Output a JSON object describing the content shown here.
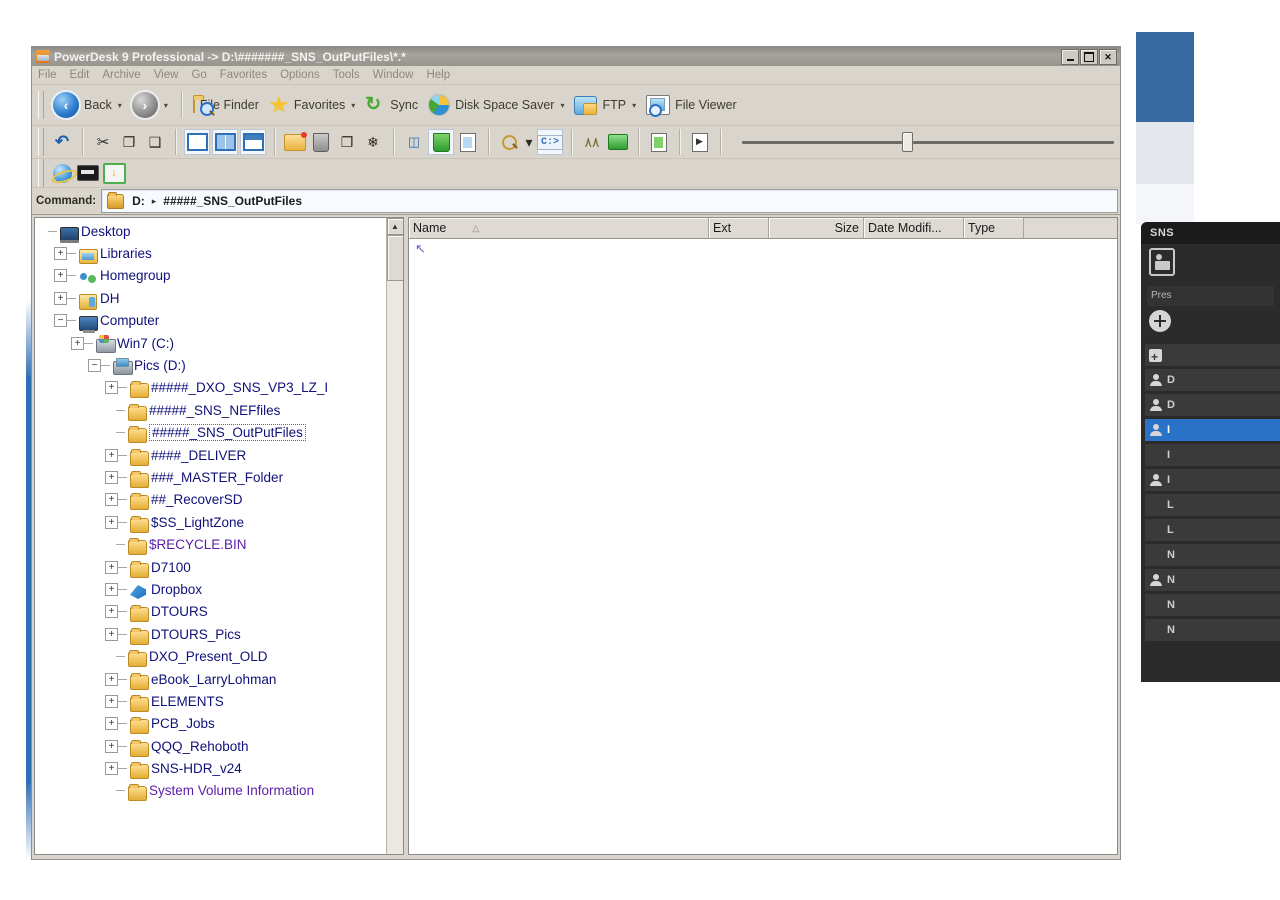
{
  "window": {
    "title": "PowerDesk 9 Professional -> D:\\#######_SNS_OutPutFiles\\*.*",
    "minimize_label": "_",
    "maximize_label": "□",
    "close_label": "✕"
  },
  "menu": {
    "items": [
      "File",
      "Edit",
      "Archive",
      "View",
      "Go",
      "Favorites",
      "Options",
      "Tools",
      "Window",
      "Help"
    ]
  },
  "toolbar": {
    "back_label": "Back",
    "back_caret": "▾",
    "forward_caret": "▾",
    "back_glyph": "‹",
    "forward_glyph": "›",
    "file_finder_label": "File Finder",
    "favorites_label": "Favorites",
    "favorites_caret": "▾",
    "sync_label": "Sync",
    "sync_glyph": "↻",
    "disk_space_saver_label": "Disk Space Saver",
    "disk_caret": "▾",
    "ftp_label": "FTP",
    "ftp_caret": "▾",
    "file_viewer_label": "File Viewer"
  },
  "toolbar2": {
    "undo_glyph": "↶",
    "cut_glyph": "✂",
    "copy_glyph": "❐",
    "paste_glyph": "❑",
    "compress_glyph": "❄",
    "cmd_prompt_label": "C:>",
    "binoculars_glyph": "٨٨",
    "magnify_caret": "▾"
  },
  "toolbar3": {
    "browser_name": "internet-explorer",
    "card_name": "card",
    "download_glyph": "↓"
  },
  "command_bar": {
    "label": "Command:",
    "drive": "D:",
    "separator": "▸",
    "folder": "#####_SNS_OutPutFiles"
  },
  "tree": {
    "items": [
      {
        "label": "Desktop",
        "depth": 0,
        "expander": "none",
        "icon": "desktop-icon",
        "color": "blue",
        "selected": false
      },
      {
        "label": "Libraries",
        "depth": 1,
        "expander": "plus",
        "icon": "libraries-icon",
        "color": "blue",
        "selected": false
      },
      {
        "label": "Homegroup",
        "depth": 1,
        "expander": "plus",
        "icon": "homegroup-icon",
        "color": "blue",
        "selected": false
      },
      {
        "label": "DH",
        "depth": 1,
        "expander": "plus",
        "icon": "user-folder-icon",
        "color": "blue",
        "selected": false
      },
      {
        "label": "Computer",
        "depth": 1,
        "expander": "minus",
        "icon": "computer-icon",
        "color": "blue",
        "selected": false
      },
      {
        "label": "Win7 (C:)",
        "depth": 2,
        "expander": "plus",
        "icon": "drive-c-icon",
        "color": "blue",
        "selected": false
      },
      {
        "label": "Pics (D:)",
        "depth": 3,
        "expander": "minus",
        "icon": "drive-d-icon",
        "color": "blue",
        "selected": false
      },
      {
        "label": "#####_DXO_SNS_VP3_LZ_I",
        "depth": 4,
        "expander": "plus",
        "icon": "folder-icon",
        "color": "blue",
        "selected": false
      },
      {
        "label": "#####_SNS_NEFfiles",
        "depth": 4,
        "expander": "none",
        "icon": "folder-icon",
        "color": "blue",
        "selected": false
      },
      {
        "label": "#####_SNS_OutPutFiles",
        "depth": 4,
        "expander": "none",
        "icon": "folder-icon",
        "color": "blue",
        "selected": true
      },
      {
        "label": "####_DELIVER",
        "depth": 4,
        "expander": "plus",
        "icon": "folder-icon",
        "color": "blue",
        "selected": false
      },
      {
        "label": "###_MASTER_Folder",
        "depth": 4,
        "expander": "plus",
        "icon": "folder-icon",
        "color": "blue",
        "selected": false
      },
      {
        "label": "##_RecoverSD",
        "depth": 4,
        "expander": "plus",
        "icon": "folder-icon",
        "color": "blue",
        "selected": false
      },
      {
        "label": "$SS_LightZone",
        "depth": 4,
        "expander": "plus",
        "icon": "folder-icon",
        "color": "blue",
        "selected": false
      },
      {
        "label": "$RECYCLE.BIN",
        "depth": 4,
        "expander": "none",
        "icon": "folder-icon",
        "color": "purple",
        "selected": false
      },
      {
        "label": "D7100",
        "depth": 4,
        "expander": "plus",
        "icon": "folder-icon",
        "color": "blue",
        "selected": false
      },
      {
        "label": "Dropbox",
        "depth": 4,
        "expander": "plus",
        "icon": "dropbox-icon",
        "color": "blue",
        "selected": false
      },
      {
        "label": "DTOURS",
        "depth": 4,
        "expander": "plus",
        "icon": "folder-icon",
        "color": "blue",
        "selected": false
      },
      {
        "label": "DTOURS_Pics",
        "depth": 4,
        "expander": "plus",
        "icon": "folder-icon",
        "color": "blue",
        "selected": false
      },
      {
        "label": "DXO_Present_OLD",
        "depth": 4,
        "expander": "none",
        "icon": "folder-icon",
        "color": "blue",
        "selected": false
      },
      {
        "label": "eBook_LarryLohman",
        "depth": 4,
        "expander": "plus",
        "icon": "folder-icon",
        "color": "blue",
        "selected": false
      },
      {
        "label": "ELEMENTS",
        "depth": 4,
        "expander": "plus",
        "icon": "folder-icon",
        "color": "blue",
        "selected": false
      },
      {
        "label": "PCB_Jobs",
        "depth": 4,
        "expander": "plus",
        "icon": "folder-icon",
        "color": "blue",
        "selected": false
      },
      {
        "label": "QQQ_Rehoboth",
        "depth": 4,
        "expander": "plus",
        "icon": "folder-icon",
        "color": "blue",
        "selected": false
      },
      {
        "label": "SNS-HDR_v24",
        "depth": 4,
        "expander": "plus",
        "icon": "folder-icon",
        "color": "blue",
        "selected": false
      },
      {
        "label": "System Volume Information",
        "depth": 4,
        "expander": "none",
        "icon": "folder-icon",
        "color": "purple",
        "selected": false
      }
    ],
    "scroll_up_glyph": "▲",
    "scroll_down_glyph": "▼",
    "expander_plus": "+",
    "expander_minus": "−"
  },
  "file_list": {
    "columns": [
      {
        "label": "Name",
        "sort": "△"
      },
      {
        "label": "Ext",
        "sort": ""
      },
      {
        "label": "Size",
        "sort": ""
      },
      {
        "label": "Date Modifi...",
        "sort": ""
      },
      {
        "label": "Type",
        "sort": ""
      }
    ],
    "rows": [
      {
        "name": "↖",
        "ext": "",
        "size": "",
        "date": "",
        "type": ""
      }
    ]
  },
  "sns_panel": {
    "title": "SNS",
    "press_label": "Pres",
    "items": [
      {
        "label": "",
        "icon": "plus-square-icon",
        "selected": false,
        "lead": "square"
      },
      {
        "label": "D",
        "icon": "person-icon",
        "selected": false,
        "lead": "person"
      },
      {
        "label": "D",
        "icon": "person-icon",
        "selected": false,
        "lead": "person"
      },
      {
        "label": "I",
        "icon": "person-icon",
        "selected": true,
        "lead": "person"
      },
      {
        "label": "I",
        "icon": "",
        "selected": false,
        "lead": "none"
      },
      {
        "label": "I",
        "icon": "person-icon",
        "selected": false,
        "lead": "person"
      },
      {
        "label": "L",
        "icon": "",
        "selected": false,
        "lead": "none"
      },
      {
        "label": "L",
        "icon": "",
        "selected": false,
        "lead": "none"
      },
      {
        "label": "N",
        "icon": "",
        "selected": false,
        "lead": "none"
      },
      {
        "label": "N",
        "icon": "person-icon",
        "selected": false,
        "lead": "person"
      },
      {
        "label": "N",
        "icon": "",
        "selected": false,
        "lead": "none"
      },
      {
        "label": "N",
        "icon": "",
        "selected": false,
        "lead": "none"
      }
    ]
  },
  "colors": {
    "title_bar": "#97948e",
    "chrome": "#d9d5cc",
    "tree_text": "#10107a",
    "tree_text_alt": "#5b1ea8",
    "selection_blue": "#2a72c8",
    "background_blue": "#36699f",
    "dark_panel": "#2b2b2b"
  }
}
